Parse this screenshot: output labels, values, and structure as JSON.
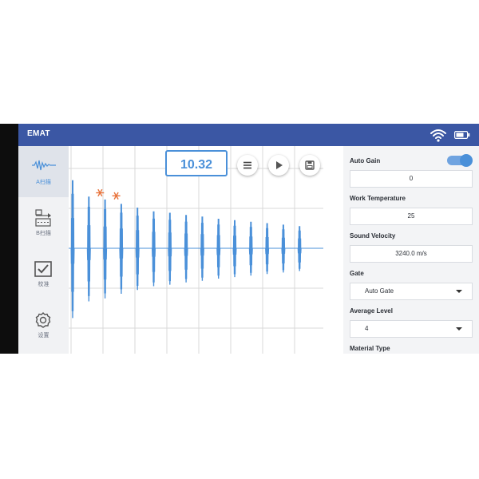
{
  "header": {
    "title": "EMAT"
  },
  "icons": {
    "wifi": "wifi-icon",
    "battery": "battery-icon"
  },
  "sidebar": {
    "items": [
      {
        "label": "A扫描",
        "icon": "a-scan-waveform-icon",
        "active": true
      },
      {
        "label": "B扫描",
        "icon": "b-scan-icon",
        "active": false
      },
      {
        "label": "校准",
        "icon": "checkbox-icon",
        "active": false
      },
      {
        "label": "设置",
        "icon": "gear-icon",
        "active": false
      }
    ]
  },
  "readout": {
    "value": "10.32"
  },
  "toolbar": {
    "menu": "menu-icon",
    "play": "play-icon",
    "save": "save-icon"
  },
  "panel": {
    "auto_gain": {
      "label": "Auto Gain",
      "enabled": true,
      "value": "0"
    },
    "work_temperature": {
      "label": "Work Temperature",
      "value": "25"
    },
    "sound_velocity": {
      "label": "Sound Velocity",
      "value": "3240.0 m/s"
    },
    "gate": {
      "label": "Gate",
      "value": "Auto Gate"
    },
    "average_level": {
      "label": "Average Level",
      "value": "4"
    },
    "material_type": {
      "label": "Material Type"
    }
  },
  "chart_data": {
    "type": "line",
    "series": [
      {
        "values": [
          0.92,
          0.7,
          0.66,
          0.6,
          0.55,
          0.5,
          0.48,
          0.45,
          0.43,
          0.4,
          0.38,
          0.36,
          0.34,
          0.32,
          0.3
        ]
      }
    ],
    "markers": [
      1,
      2
    ],
    "colors": {
      "signal": "#4a90d9",
      "marker": "#e8723a",
      "grid": "#d8d8d8"
    }
  }
}
